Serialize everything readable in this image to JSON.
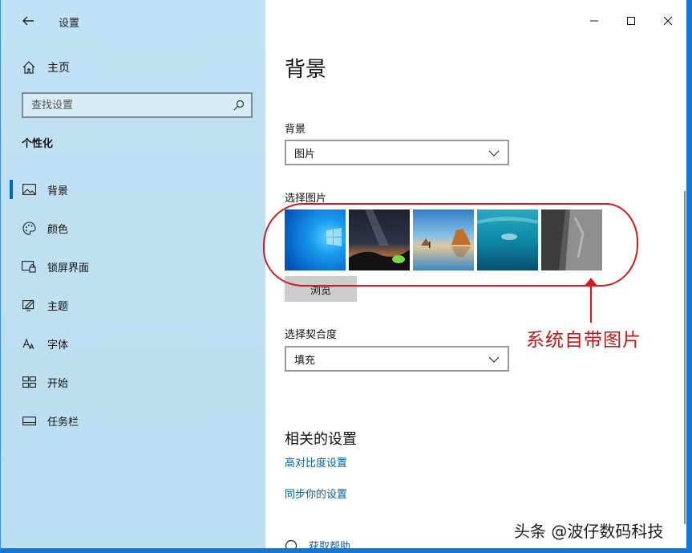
{
  "window": {
    "title": "设置"
  },
  "sidebar": {
    "home_label": "主页",
    "search_placeholder": "查找设置",
    "section_label": "个性化",
    "items": [
      {
        "label": "背景",
        "icon": "picture-icon",
        "active": true
      },
      {
        "label": "颜色",
        "icon": "palette-icon"
      },
      {
        "label": "锁屏界面",
        "icon": "lock-screen-icon"
      },
      {
        "label": "主题",
        "icon": "theme-icon"
      },
      {
        "label": "字体",
        "icon": "font-icon"
      },
      {
        "label": "开始",
        "icon": "start-icon"
      },
      {
        "label": "任务栏",
        "icon": "taskbar-icon"
      }
    ]
  },
  "main": {
    "page_title": "背景",
    "background_label": "背景",
    "background_value": "图片",
    "choose_picture_label": "选择图片",
    "browse_label": "浏览",
    "fit_label": "选择契合度",
    "fit_value": "填充",
    "related_title": "相关的设置",
    "links": [
      "高对比度设置",
      "同步你的设置"
    ],
    "help_label": "获取帮助"
  },
  "annotation": {
    "text": "系统自带图片",
    "color": "#d51c1c"
  },
  "watermark": "头条 @波仔数码科技",
  "colors": {
    "accent": "#0067c0",
    "link": "#0063b1",
    "sidebar_bg": "#bfe0f1"
  }
}
